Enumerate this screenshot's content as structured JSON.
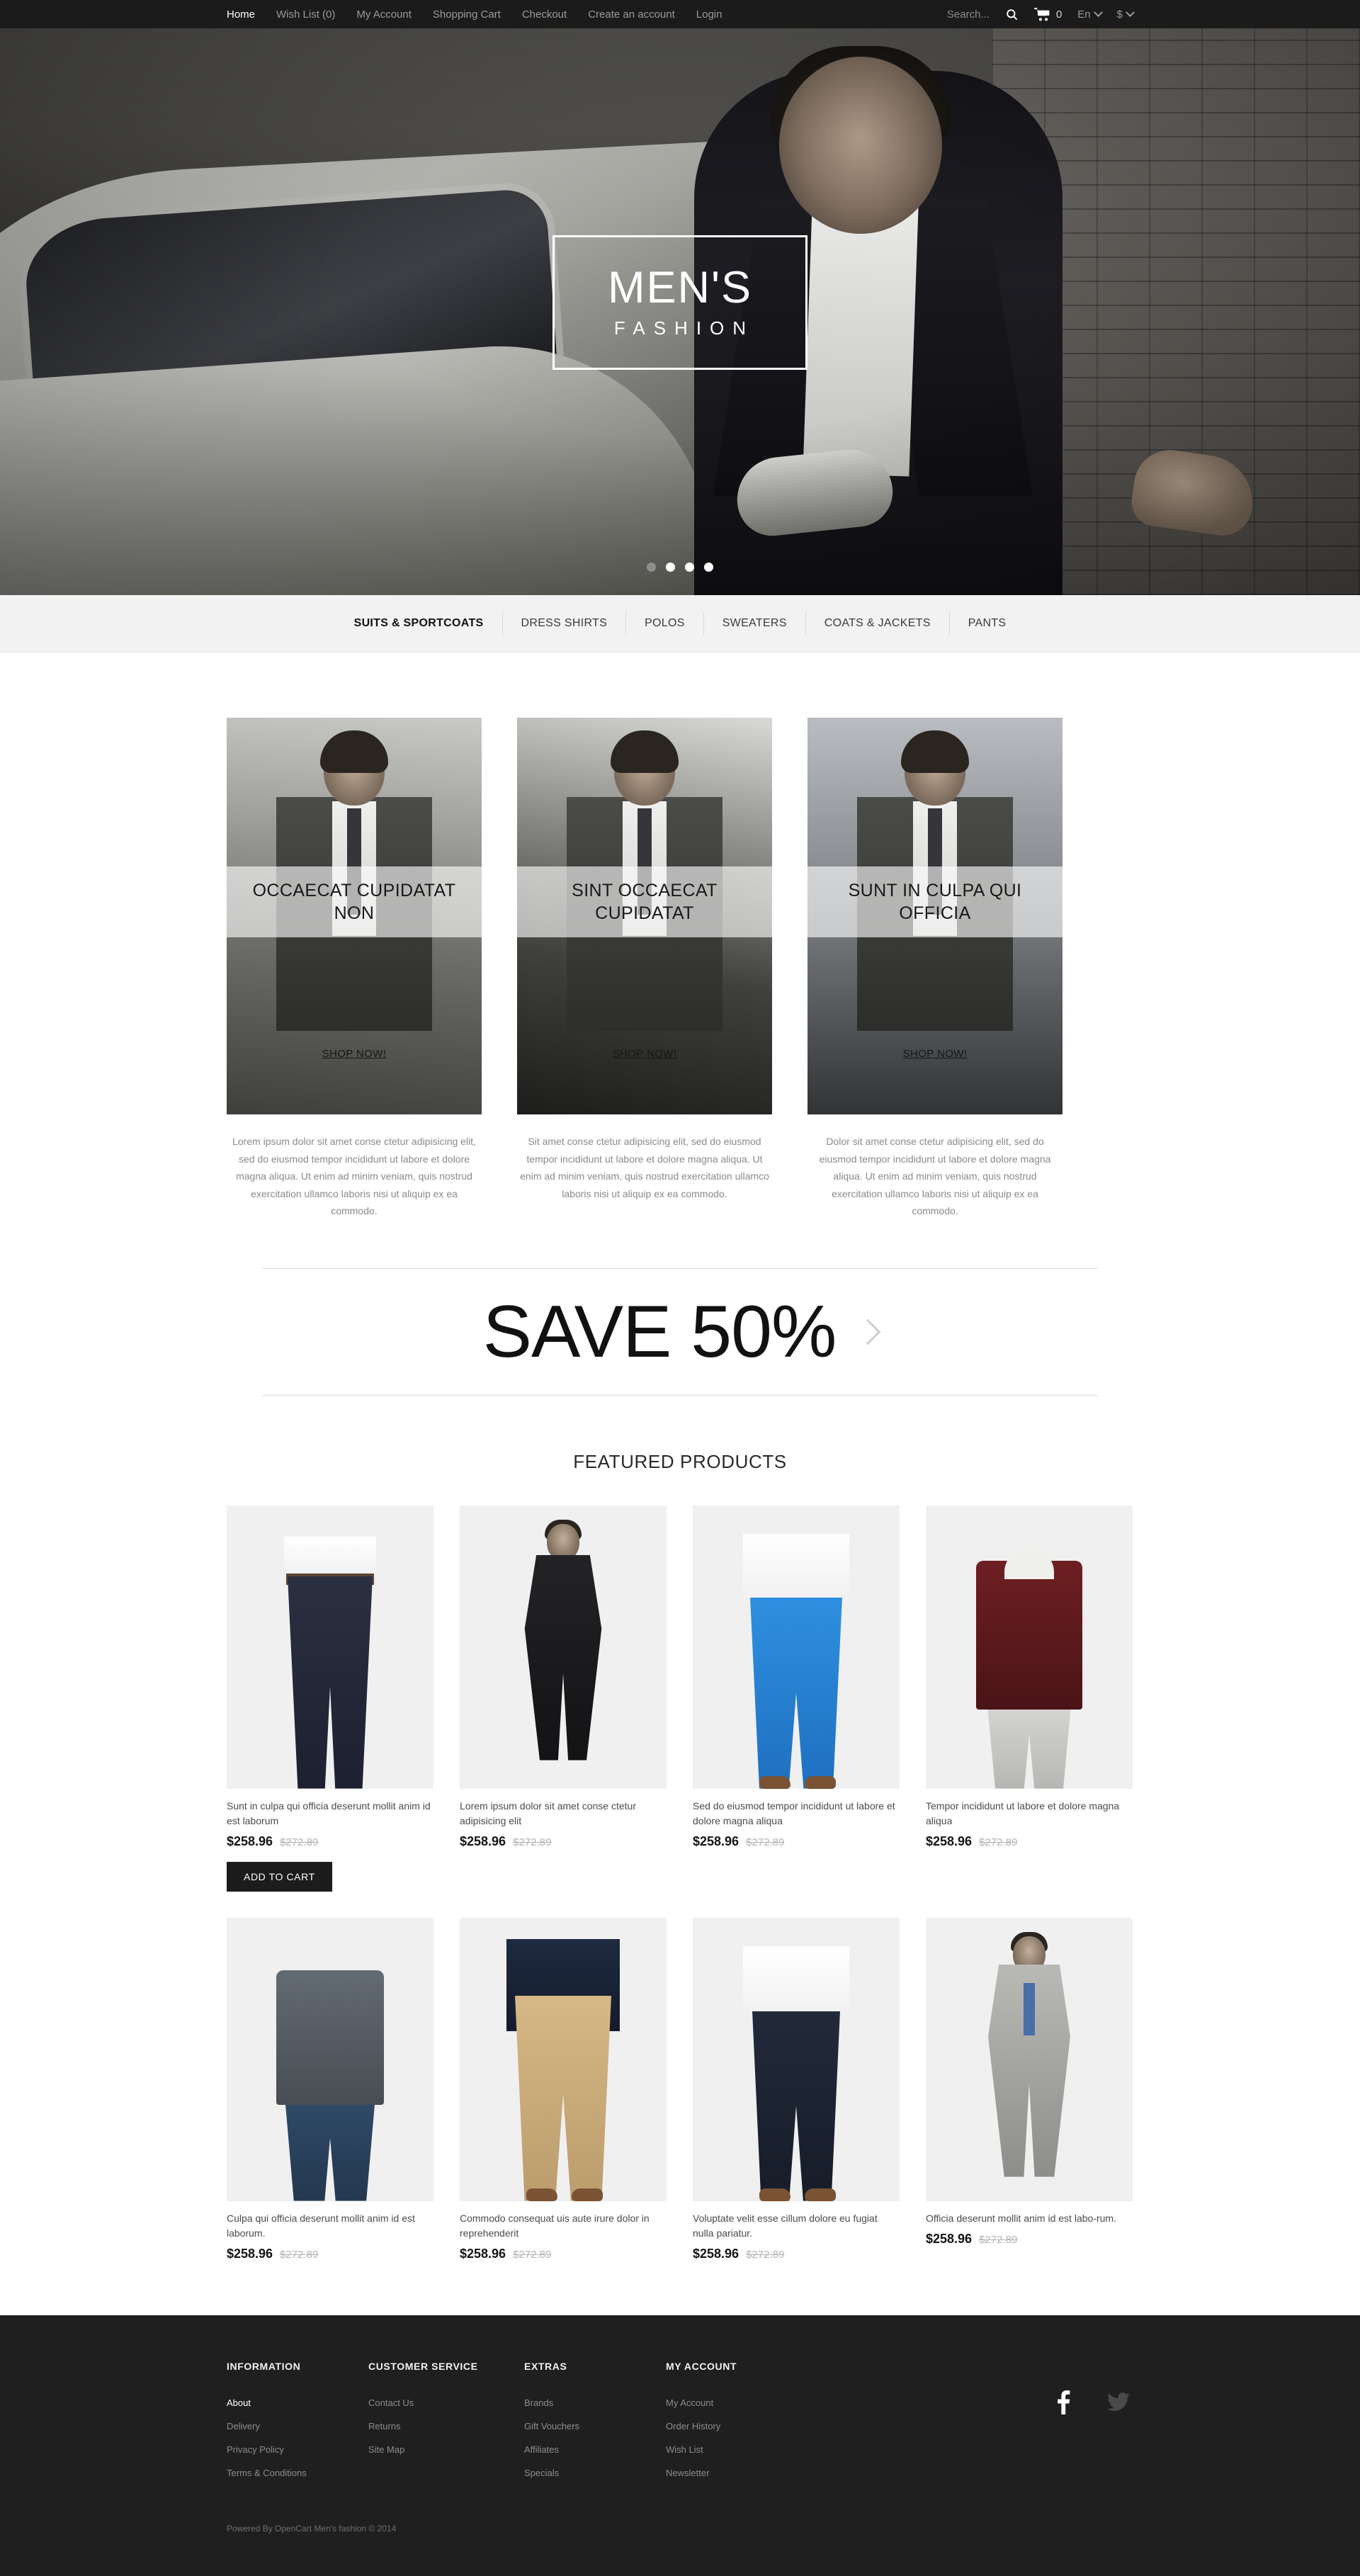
{
  "topbar": {
    "links": [
      {
        "label": "Home",
        "active": true
      },
      {
        "label": "Wish List (0)",
        "active": false
      },
      {
        "label": "My Account",
        "active": false
      },
      {
        "label": "Shopping Cart",
        "active": false
      },
      {
        "label": "Checkout",
        "active": false
      },
      {
        "label": "Create an account",
        "active": false
      },
      {
        "label": "Login",
        "active": false
      }
    ],
    "search_placeholder": "Search...",
    "search_value": "",
    "cart_count": "0",
    "language": "En",
    "currency": "$"
  },
  "hero": {
    "logo_main": "MEN'S",
    "logo_sub": "FASHION",
    "slides": 4,
    "active_slide": 1
  },
  "category_menu": [
    {
      "label": "SUITS & SPORTCOATS",
      "active": true
    },
    {
      "label": "DRESS SHIRTS",
      "active": false
    },
    {
      "label": "POLOS",
      "active": false
    },
    {
      "label": "SWEATERS",
      "active": false
    },
    {
      "label": "COATS & JACKETS",
      "active": false
    },
    {
      "label": "PANTS",
      "active": false
    }
  ],
  "promos": [
    {
      "caption": "OCCAECAT CUPIDATAT NON",
      "cta": "SHOP NOW!",
      "text": "Lorem ipsum dolor sit amet conse ctetur adipisicing elit, sed do eiusmod tempor incididunt ut labore et dolore magna aliqua. Ut enim ad minim veniam, quis nostrud exercitation ullamco laboris nisi ut aliquip ex ea commodo."
    },
    {
      "caption": "SINT OCCAECAT CUPIDATAT",
      "cta": "SHOP NOW!",
      "text": "Sit amet conse ctetur adipisicing elit, sed do eiusmod tempor incididunt ut labore et dolore magna aliqua. Ut enim ad minim veniam, quis nostrud exercitation ullamco laboris nisi ut aliquip ex ea commodo."
    },
    {
      "caption": "SUNT IN CULPA QUI OFFICIA",
      "cta": "SHOP NOW!",
      "text": "Dolor sit amet conse ctetur adipisicing elit, sed do eiusmod tempor incididunt ut labore et dolore magna aliqua. Ut enim ad minim veniam, quis nostrud exercitation ullamco laboris nisi ut aliquip ex ea commodo."
    }
  ],
  "save_banner": {
    "text": "SAVE 50%",
    "next_arrow": "chevron-right"
  },
  "featured": {
    "title": "FEATURED PRODUCTS",
    "add_to_cart_label": "ADD TO CART",
    "products": [
      {
        "name": "Sunt in culpa qui officia deserunt mollit anim id est laborum",
        "price": "$258.96",
        "old_price": "$272.89",
        "has_add_to_cart": true
      },
      {
        "name": "Lorem ipsum dolor sit amet conse ctetur adipisicing elit",
        "price": "$258.96",
        "old_price": "$272.89",
        "has_add_to_cart": false
      },
      {
        "name": "Sed do eiusmod tempor incididunt ut labore et dolore magna aliqua",
        "price": "$258.96",
        "old_price": "$272.89",
        "has_add_to_cart": false
      },
      {
        "name": "Tempor incididunt ut labore et dolore magna aliqua",
        "price": "$258.96",
        "old_price": "$272.89",
        "has_add_to_cart": false
      },
      {
        "name": "Culpa qui officia deserunt mollit anim id est laborum.",
        "price": "$258.96",
        "old_price": "$272.89",
        "has_add_to_cart": false
      },
      {
        "name": "Commodo consequat uis aute irure dolor in reprehenderit",
        "price": "$258.96",
        "old_price": "$272.89",
        "has_add_to_cart": false
      },
      {
        "name": "Voluptate velit esse cillum dolore eu fugiat nulla pariatur.",
        "price": "$258.96",
        "old_price": "$272.89",
        "has_add_to_cart": false
      },
      {
        "name": "Officia deserunt mollit anim id est labo-rum.",
        "price": "$258.96",
        "old_price": "$272.89",
        "has_add_to_cart": false
      }
    ]
  },
  "footer": {
    "columns": [
      {
        "title": "INFORMATION",
        "links": [
          {
            "label": "About",
            "active": true
          },
          {
            "label": "Delivery",
            "active": false
          },
          {
            "label": "Privacy Policy",
            "active": false
          },
          {
            "label": "Terms & Conditions",
            "active": false
          }
        ]
      },
      {
        "title": "CUSTOMER SERVICE",
        "links": [
          {
            "label": "Contact Us",
            "active": false
          },
          {
            "label": "Returns",
            "active": false
          },
          {
            "label": "Site Map",
            "active": false
          }
        ]
      },
      {
        "title": "EXTRAS",
        "links": [
          {
            "label": "Brands",
            "active": false
          },
          {
            "label": "Gift Vouchers",
            "active": false
          },
          {
            "label": "Affiliates",
            "active": false
          },
          {
            "label": "Specials",
            "active": false
          }
        ]
      },
      {
        "title": "MY ACCOUNT",
        "links": [
          {
            "label": "My Account",
            "active": false
          },
          {
            "label": "Order History",
            "active": false
          },
          {
            "label": "Wish List",
            "active": false
          },
          {
            "label": "Newsletter",
            "active": false
          }
        ]
      }
    ],
    "social": [
      "facebook-icon",
      "twitter-icon"
    ],
    "copyright": "Powered By OpenCart Men's fashion © 2014"
  },
  "colors": {
    "topbar_bg": "#1b1b1b",
    "menu_bg": "#f2f2f2",
    "footer_bg": "#1f1f1f",
    "button_bg": "#1c1c1c",
    "old_price": "#b3b3b3"
  }
}
